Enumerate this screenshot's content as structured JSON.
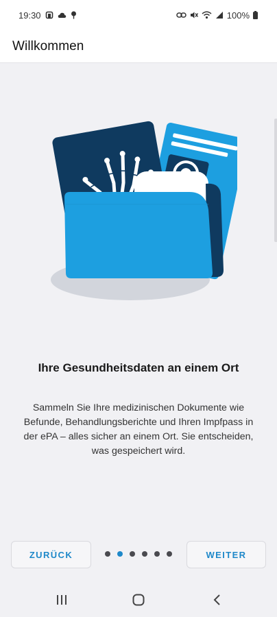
{
  "status_bar": {
    "time": "19:30",
    "battery": "100%",
    "icons_left": [
      "notification-icon",
      "cloud-icon",
      "location-icon"
    ],
    "icons_right": [
      "link-icon",
      "mute-icon",
      "wifi-icon",
      "signal-icon",
      "battery-icon"
    ]
  },
  "app_bar": {
    "title": "Willkommen"
  },
  "onboarding": {
    "illustration": "health-documents-folder-illustration",
    "headline": "Ihre Gesundheitsdaten an einem Ort",
    "description": "Sammeln Sie Ihre medizinischen Dokumente wie Befunde, Behandlungsberichte und Ihren Impfpass in der ePA – alles sicher an einem Ort. Sie entscheiden, was gespeichert wird."
  },
  "footer": {
    "back_label": "ZURÜCK",
    "next_label": "WEITER",
    "page_count": 6,
    "current_page": 2
  },
  "colors": {
    "accent": "#1e88c9",
    "folder": "#1d9fe0",
    "dark_card": "#0f3a5f"
  },
  "nav_bar": {
    "icons": [
      "recent-apps-icon",
      "home-icon",
      "back-icon"
    ]
  }
}
